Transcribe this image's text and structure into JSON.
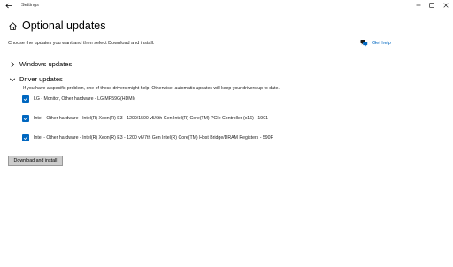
{
  "window": {
    "title": "Settings"
  },
  "header": {
    "title": "Optional updates",
    "subtitle": "Choose the updates you want and then select Download and install.",
    "help_link": "Get help"
  },
  "sections": {
    "windows_updates": {
      "label": "Windows updates",
      "expanded": false
    },
    "driver_updates": {
      "label": "Driver updates",
      "expanded": true,
      "description": "If you have a specific problem, one of these drivers might help. Otherwise, automatic updates will keep your drivers up to date.",
      "items": [
        {
          "label": "LG - Monitor, Other hardware - LG MP59G(HDMI)",
          "checked": true
        },
        {
          "label": "Intel - Other hardware - Intel(R) Xeon(R) E3 - 1200/1500 v5/6th Gen Intel(R) Core(TM) PCIe Controller (x16) - 1901",
          "checked": true
        },
        {
          "label": "Intel - Other hardware - Intel(R) Xeon(R) E3 - 1200 v6/7th Gen Intel(R) Core(TM) Host Bridge/DRAM Registers - 590F",
          "checked": true
        }
      ]
    }
  },
  "actions": {
    "download_label": "Download and install"
  },
  "colors": {
    "accent": "#0067c0",
    "button_bg": "#cccccc",
    "background": "#ffffff"
  },
  "icons": {
    "back": "arrow-left-icon",
    "home": "home-icon",
    "help": "help-chat-icon",
    "minimize": "minimize-icon",
    "maximize": "maximize-icon",
    "close": "close-icon",
    "collapsed": "chevron-right-icon",
    "expanded": "chevron-down-icon",
    "check": "checkmark-icon"
  }
}
